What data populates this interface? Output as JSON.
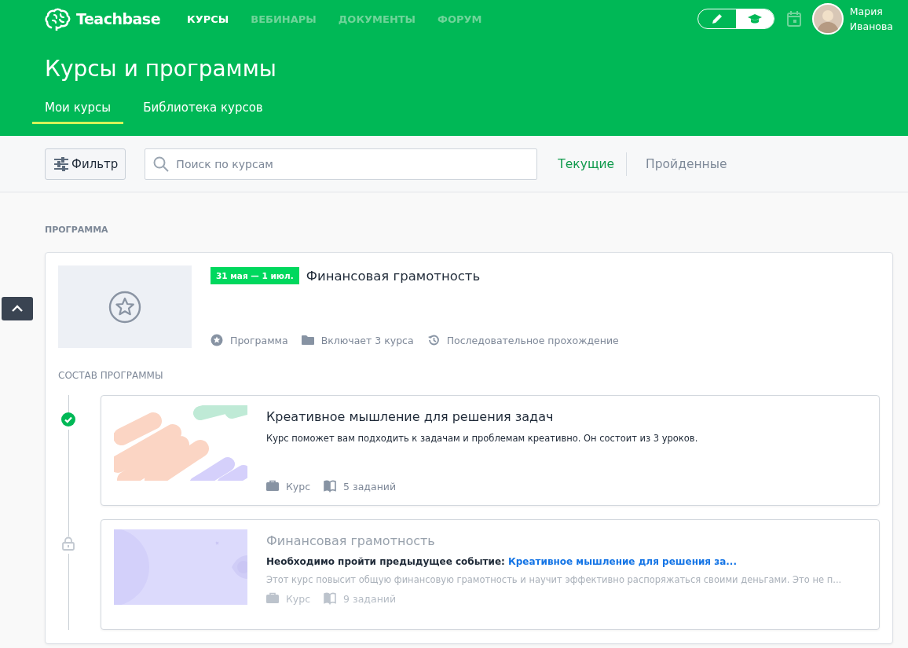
{
  "header": {
    "logo": "Teachbase",
    "nav": [
      {
        "label": "КУРСЫ",
        "selected": true
      },
      {
        "label": "ВЕБИНАРЫ",
        "selected": false
      },
      {
        "label": "ДОКУМЕНТЫ",
        "selected": false
      },
      {
        "label": "ФОРУМ",
        "selected": false
      }
    ],
    "mode_toggle": [
      {
        "kind": "edit",
        "selected": false
      },
      {
        "kind": "learn",
        "selected": true
      }
    ],
    "user": {
      "first_name": "Мария",
      "last_name": "Иванова"
    }
  },
  "page_title": "Курсы и программы",
  "tabs": [
    {
      "label": "Мои курсы",
      "selected": true
    },
    {
      "label": "Библиотека курсов",
      "selected": false
    }
  ],
  "toolbar": {
    "filter_button": "Фильтр",
    "search": {
      "placeholder": "Поиск по курсам"
    },
    "status_tabs": [
      {
        "label": "Текущие",
        "selected": true
      },
      {
        "label": "Пройденные",
        "selected": false
      }
    ]
  },
  "section_label": "ПРОГРАММА",
  "program": {
    "date_badge": "31 мая — 1 июл.",
    "title": "Финансовая грамотность",
    "meta": [
      {
        "kind": "program",
        "text": "Программа"
      },
      {
        "kind": "folder",
        "text": "Включает 3 курса"
      },
      {
        "kind": "history",
        "text": "Последовательное прохождение"
      }
    ],
    "contents_label": "СОСТАВ ПРОГРАММЫ",
    "courses": [
      {
        "completed": true,
        "title": "Креативное мышление для решения задач",
        "description": "Курс поможет вам подходить к задачам и проблемам креативно. Он состоит из 3 уроков.",
        "meta": [
          {
            "kind": "course",
            "text": "Курс"
          },
          {
            "kind": "tasks",
            "text": "5 заданий"
          }
        ]
      },
      {
        "completed": false,
        "title": "Финансовая грамотность",
        "requirement": {
          "label": "Необходимо пройти предыдущее событие:",
          "link": "Креативное мышление для решения за..."
        },
        "description": "Этот курс повысит общую финансовую грамотность и научит эффективно распоряжаться своими деньгами. Это не п...",
        "meta": [
          {
            "kind": "course",
            "text": "Курс"
          },
          {
            "kind": "tasks",
            "text": "9 заданий"
          }
        ]
      }
    ]
  }
}
